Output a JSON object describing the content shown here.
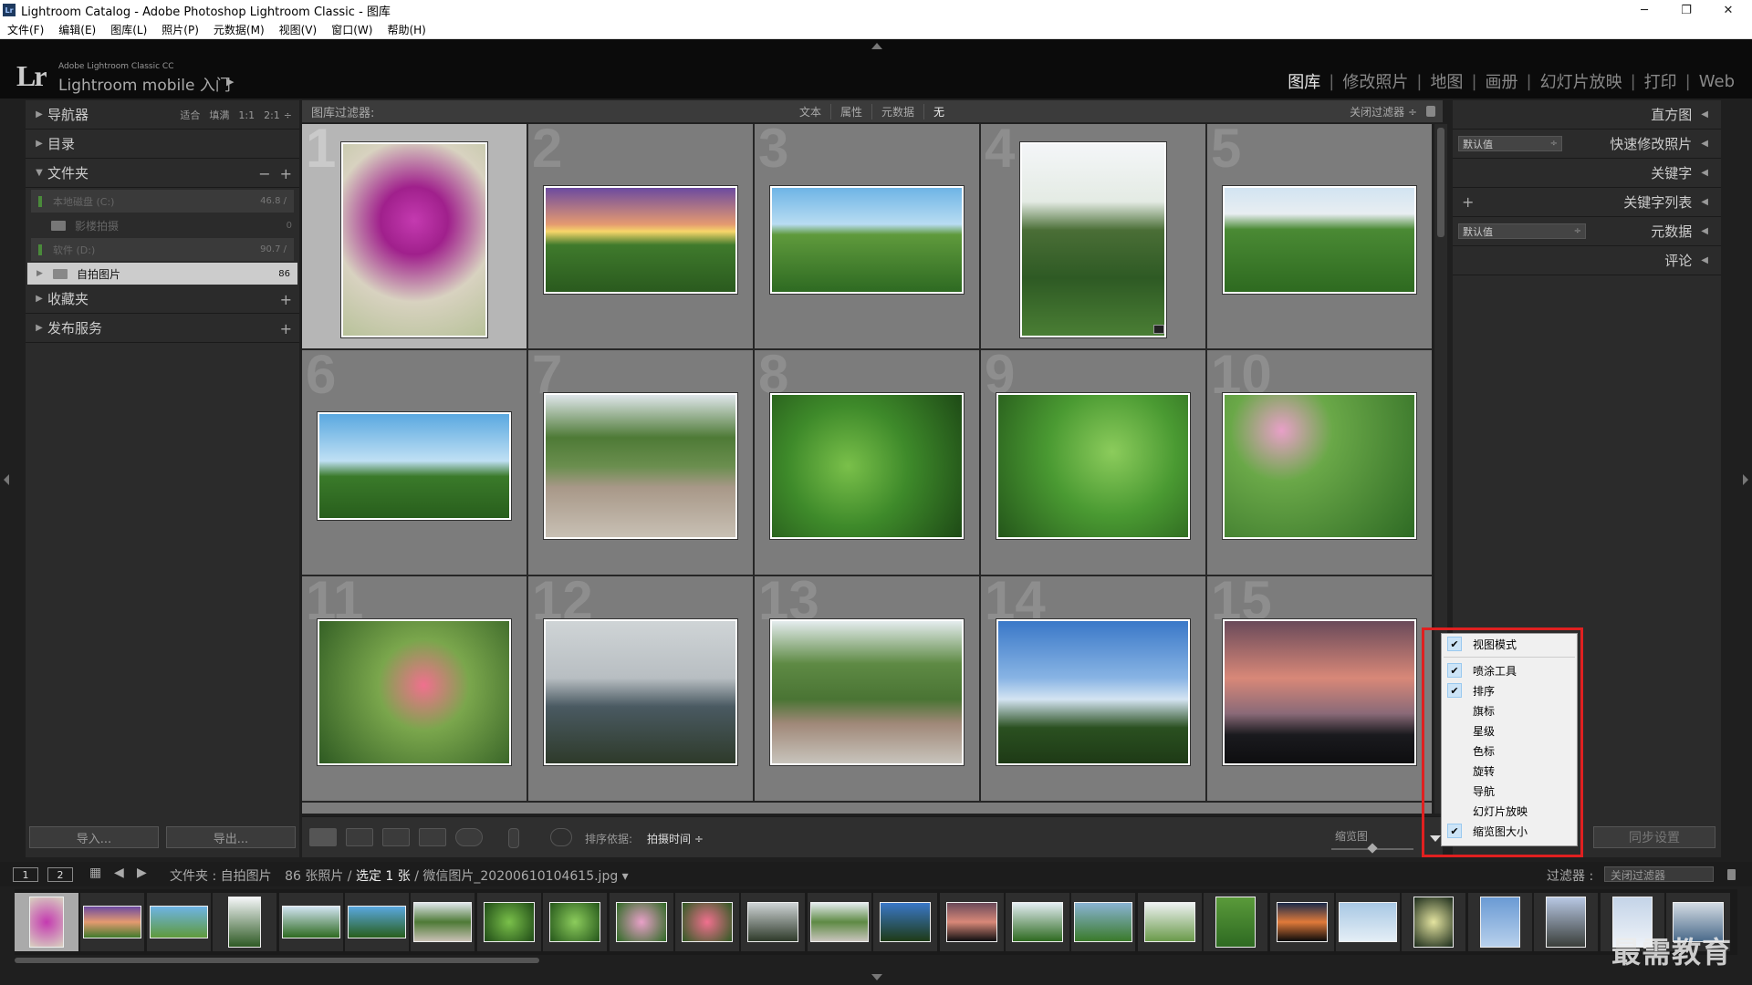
{
  "window": {
    "title": "Lightroom Catalog - Adobe Photoshop Lightroom Classic - 图库",
    "app_icon": "Lr",
    "minimize": "─",
    "restore": "❐",
    "close": "✕"
  },
  "menu": [
    "文件(F)",
    "编辑(E)",
    "图库(L)",
    "照片(P)",
    "元数据(M)",
    "视图(V)",
    "窗口(W)",
    "帮助(H)"
  ],
  "brand": {
    "logo": "Lr",
    "line1": "Adobe Lightroom Classic CC",
    "line2": "Lightroom mobile 入门",
    "arrow": "▶"
  },
  "modules": [
    "图库",
    "修改照片",
    "地图",
    "画册",
    "幻灯片放映",
    "打印",
    "Web"
  ],
  "left_panel": {
    "navigator": {
      "label": "导航器",
      "zoom": [
        "适合",
        "填满",
        "1:1",
        "2:1"
      ]
    },
    "catalog": {
      "label": "目录"
    },
    "folders": {
      "label": "文件夹",
      "minus": "−",
      "plus": "+",
      "volumes": [
        {
          "name": "本地磁盘 (C:)",
          "size": "46.8 /"
        },
        {
          "name": "软件 (D:)",
          "size": "90.7 /"
        }
      ],
      "subfolder": {
        "name": "影楼拍摄",
        "count": "0"
      },
      "selected_folder": {
        "name": "自拍图片",
        "count": "86"
      }
    },
    "collections": {
      "label": "收藏夹",
      "plus": "+"
    },
    "publish": {
      "label": "发布服务",
      "plus": "+"
    },
    "import_btn": "导入...",
    "export_btn": "导出..."
  },
  "right_panel": {
    "histogram": "直方图",
    "quick_develop": {
      "label": "快速修改照片",
      "preset": "默认值"
    },
    "keywording": "关键字",
    "keyword_list": {
      "label": "关键字列表",
      "plus": "+"
    },
    "metadata": {
      "label": "元数据",
      "preset": "默认值"
    },
    "comments": "评论",
    "sync_btn": "同步设置"
  },
  "filter_bar": {
    "title": "图库过滤器:",
    "options": [
      "文本",
      "属性",
      "元数据",
      "无"
    ],
    "active": "无",
    "preset": "关闭过滤器 ÷"
  },
  "grid": {
    "numbers": [
      "1",
      "2",
      "3",
      "4",
      "5",
      "6",
      "7",
      "8",
      "9",
      "10",
      "11",
      "12",
      "13",
      "14",
      "15"
    ],
    "selected_index": 0
  },
  "toolbar": {
    "sort_label": "排序依据:",
    "sort_value": "拍摄时间 ÷",
    "thumb_label": "缩览图",
    "thumb_size": 0.5
  },
  "context_menu": {
    "items": [
      {
        "label": "视图模式",
        "checked": true
      },
      {
        "label": "喷涂工具",
        "checked": true
      },
      {
        "label": "排序",
        "checked": true
      },
      {
        "label": "旗标",
        "checked": false
      },
      {
        "label": "星级",
        "checked": false
      },
      {
        "label": "色标",
        "checked": false
      },
      {
        "label": "旋转",
        "checked": false
      },
      {
        "label": "导航",
        "checked": false
      },
      {
        "label": "幻灯片放映",
        "checked": false
      },
      {
        "label": "缩览图大小",
        "checked": true
      }
    ],
    "checkmark": "✔"
  },
  "film_bar": {
    "page1": "1",
    "page2": "2",
    "prefix": "文件夹 : 自拍图片",
    "count": "86 张照片 /",
    "selected": "选定 1 张",
    "file": "/ 微信图片_20200610104615.jpg",
    "caret": "▾",
    "filter_label": "过滤器 :",
    "filter_value": "关闭过滤器"
  },
  "watermark": "最需教育"
}
